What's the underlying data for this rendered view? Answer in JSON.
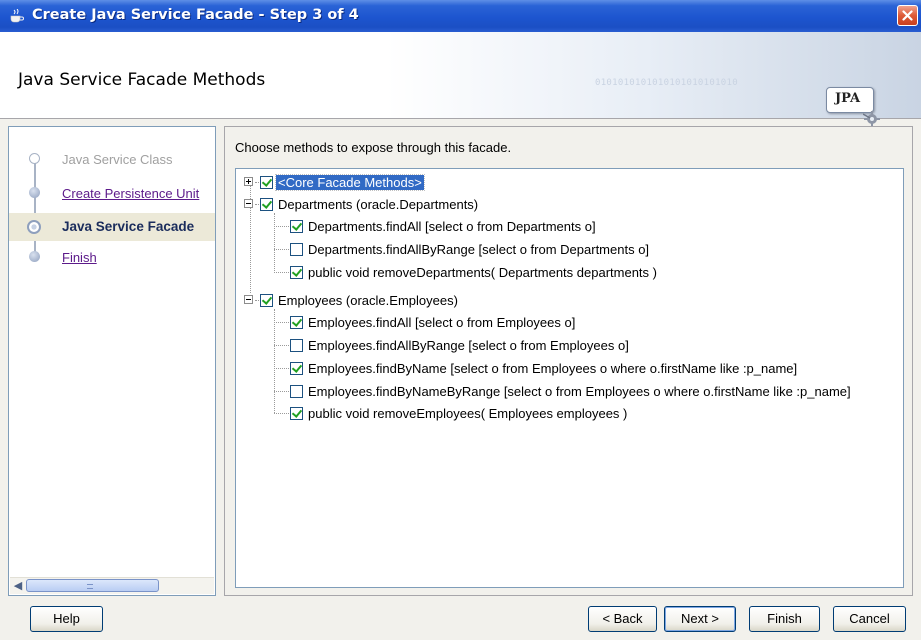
{
  "window": {
    "title": "Create Java Service Facade - Step 3 of 4"
  },
  "header": {
    "page_title": "Java Service Facade Methods",
    "binary_text": "0101010101010101010101010",
    "badge_label": "JPA"
  },
  "steps": [
    {
      "label": "Java Service Class",
      "state": "disabled"
    },
    {
      "label": "Create Persistence Unit",
      "state": "link"
    },
    {
      "label": "Java Service Facade",
      "state": "current"
    },
    {
      "label": "Finish",
      "state": "link"
    }
  ],
  "main": {
    "instruction": "Choose methods to expose through this facade.",
    "tree": [
      {
        "label": "<Core Facade Methods>",
        "level": 0,
        "expander": "plus",
        "checked": true,
        "selected": true
      },
      {
        "label": "Departments (oracle.Departments)",
        "level": 0,
        "expander": "minus",
        "checked": true
      },
      {
        "label": "Departments.findAll [select o from Departments o]",
        "level": 1,
        "checked": true
      },
      {
        "label": "Departments.findAllByRange [select o from Departments o]",
        "level": 1,
        "checked": false
      },
      {
        "label": "public void removeDepartments( Departments departments )",
        "level": 1,
        "checked": true
      },
      {
        "label": "Employees (oracle.Employees)",
        "level": 0,
        "expander": "minus",
        "checked": true
      },
      {
        "label": "Employees.findAll [select o from Employees o]",
        "level": 1,
        "checked": true
      },
      {
        "label": "Employees.findAllByRange [select o from Employees o]",
        "level": 1,
        "checked": false
      },
      {
        "label": "Employees.findByName [select o from Employees o where o.firstName like :p_name]",
        "level": 1,
        "checked": true
      },
      {
        "label": "Employees.findByNameByRange [select o from Employees o where o.firstName like :p_name]",
        "level": 1,
        "checked": false
      },
      {
        "label": "public void removeEmployees( Employees employees )",
        "level": 1,
        "checked": true
      }
    ]
  },
  "buttons": {
    "help": "Help",
    "back": "< Back",
    "next": "Next >",
    "finish": "Finish",
    "cancel": "Cancel"
  },
  "colors": {
    "title_bar": "#1d55cf",
    "selection": "#316ac5",
    "checkmark": "#21a121",
    "link": "#5c1a8a"
  }
}
